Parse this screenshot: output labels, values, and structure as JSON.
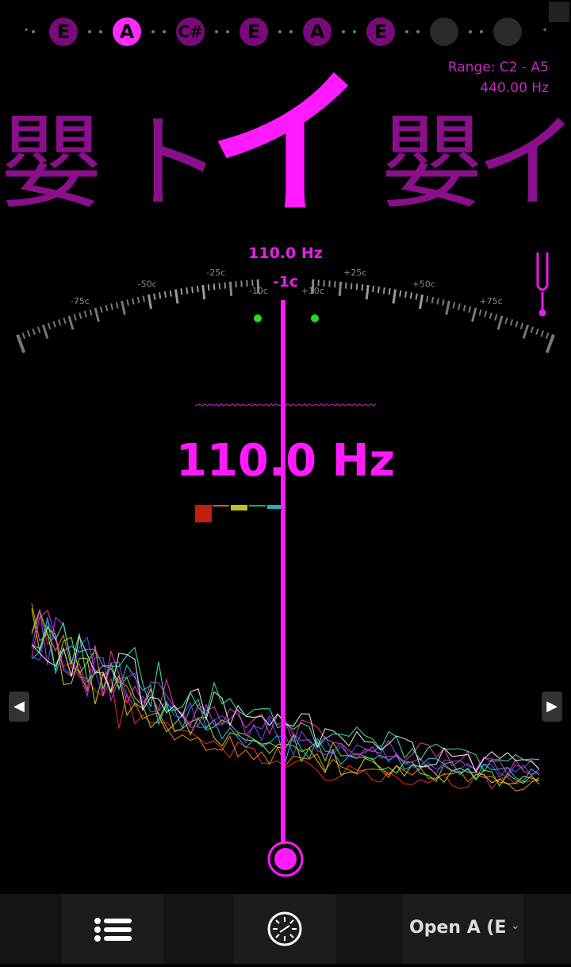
{
  "strings": {
    "notes": [
      "E",
      "A",
      "C#",
      "E",
      "A",
      "E"
    ],
    "active_index": 1,
    "empty_slots": 2
  },
  "range": {
    "label": "Range: C2 - A5",
    "reference": "440.00 Hz"
  },
  "notes_display": {
    "left2": "嬰",
    "left1": "ト",
    "center": "イ",
    "right1": "嬰",
    "right2": "イ"
  },
  "meter": {
    "target_hz": "110.0 Hz",
    "cents": "-1c",
    "tick_labels": [
      "-75c",
      "-50c",
      "-25c",
      "-10c",
      "+10c",
      "+25c",
      "+50c",
      "+75c"
    ],
    "cents_value": -1
  },
  "frequency": "110.0 Hz",
  "colors": {
    "accent": "#ff1aff",
    "dim": "#8a0f8a",
    "in_tune": "#22dd22"
  },
  "nav": {
    "prev_arrow": "◀",
    "next_arrow": "▶"
  },
  "bottom": {
    "menu_icon": "list-icon",
    "tuner_icon": "dial-icon",
    "tuning_label": "Open A (E",
    "dropdown_icon": "chevron-down-icon"
  }
}
